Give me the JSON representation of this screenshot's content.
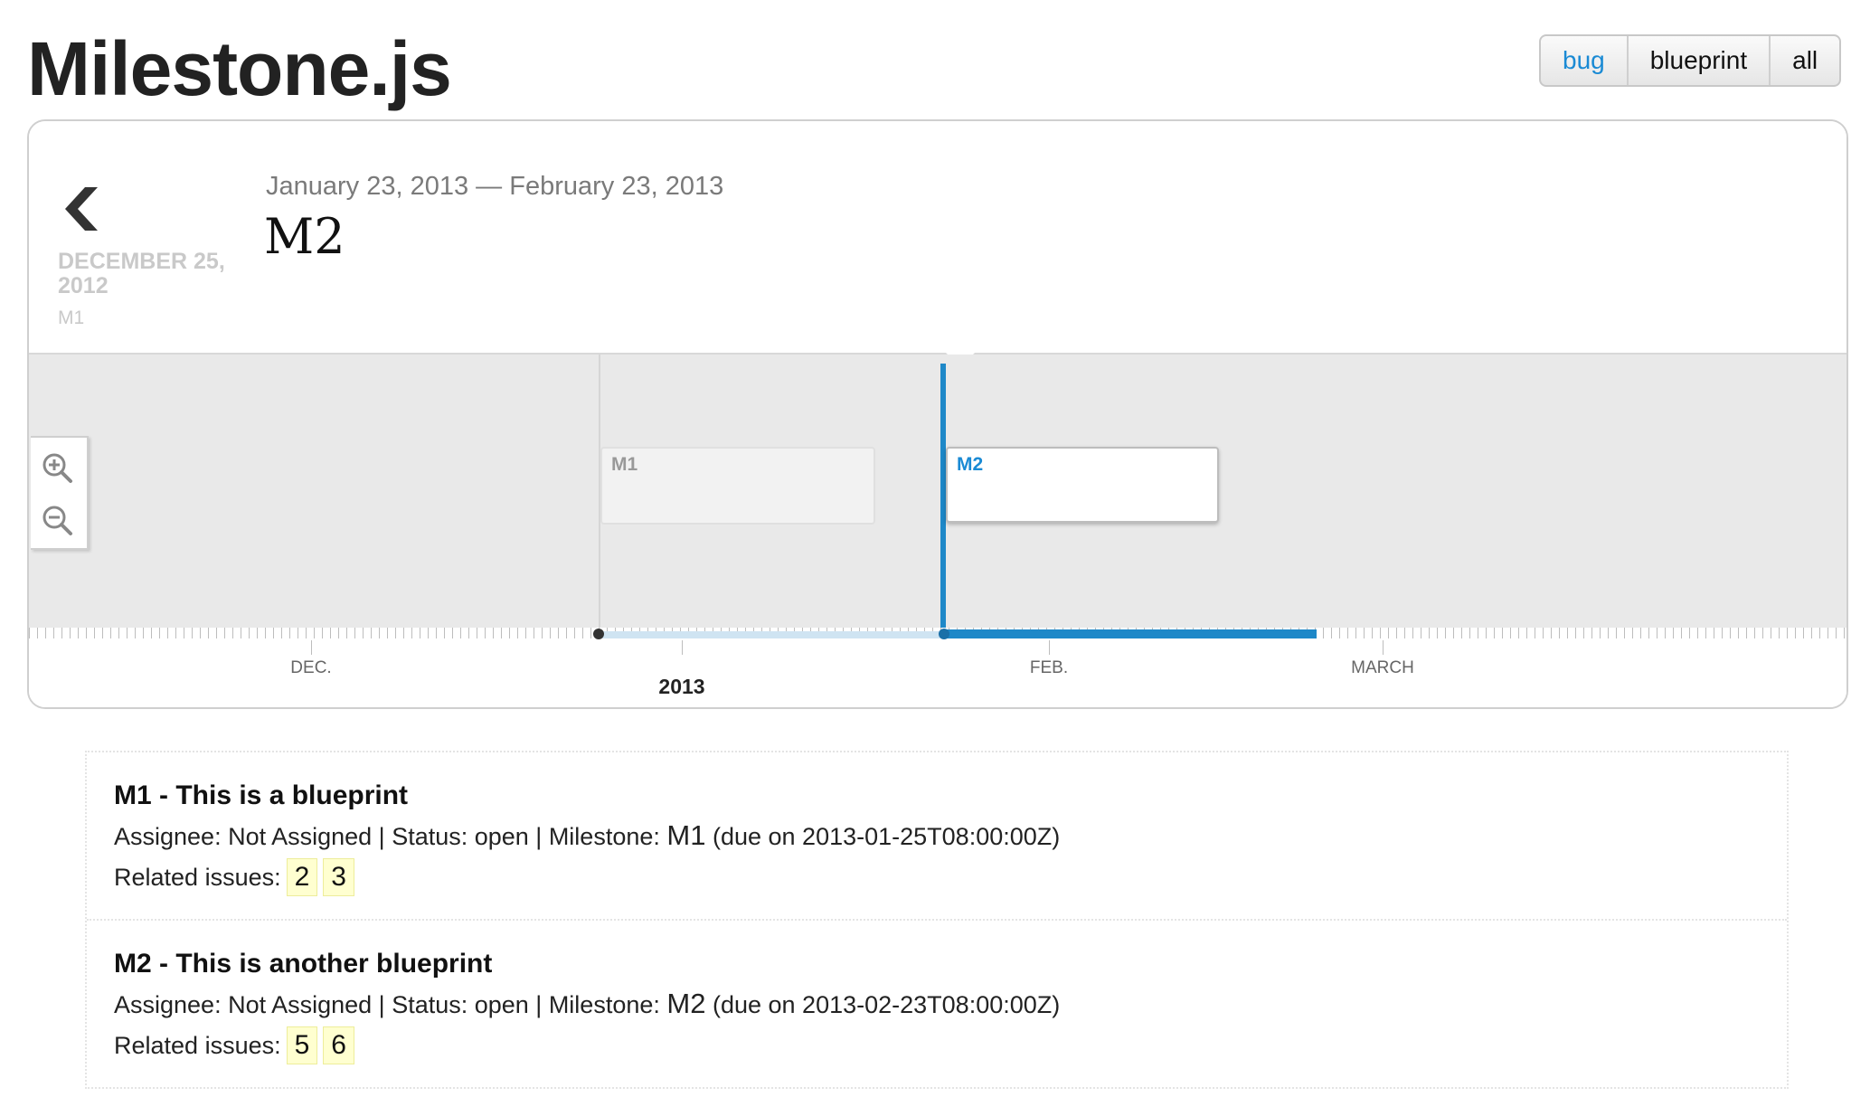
{
  "app": {
    "title": "Milestone.js"
  },
  "filters": [
    {
      "label": "bug",
      "active": true
    },
    {
      "label": "blueprint",
      "active": false
    },
    {
      "label": "all",
      "active": false
    }
  ],
  "header": {
    "previous": {
      "date": "DECEMBER 25, 2012",
      "name": "M1",
      "icon": "chevron-left-icon"
    },
    "current": {
      "range": "January 23, 2013 — February 23, 2013",
      "name": "M2"
    }
  },
  "zoom": {
    "in_icon": "zoom-in-icon",
    "out_icon": "zoom-out-icon"
  },
  "timeline": {
    "milestones": [
      {
        "label": "M1",
        "active": false
      },
      {
        "label": "M2",
        "active": true
      }
    ],
    "axis": {
      "months": [
        "DEC.",
        "FEB.",
        "MARCH"
      ],
      "year": "2013"
    }
  },
  "issues": [
    {
      "title": "M1 - This is a blueprint",
      "meta_prefix": "Assignee: Not Assigned | Status: open | Milestone:",
      "milestone": "M1",
      "due": "(due on 2013-01-25T08:00:00Z)",
      "related_label": "Related issues:",
      "related": [
        "2",
        "3"
      ]
    },
    {
      "title": "M2 - This is another blueprint",
      "meta_prefix": "Assignee: Not Assigned | Status: open | Milestone:",
      "milestone": "M2",
      "due": "(due on 2013-02-23T08:00:00Z)",
      "related_label": "Related issues:",
      "related": [
        "5",
        "6"
      ]
    }
  ],
  "colors": {
    "accent": "#1e88c8",
    "badge": "#ffffd0",
    "track": "#e9e9e9"
  }
}
